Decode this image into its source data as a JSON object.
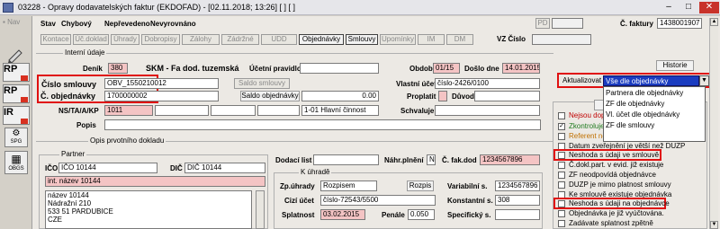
{
  "window": {
    "title": "03228 - Opravy dodavatelských faktur (EKDOFAD) - [02.11.2018; 13:26] [ ] [ ]",
    "minimize": "–",
    "maximize": "□",
    "close": "✕"
  },
  "leftbar": {
    "nav_label": "Nav",
    "btn1": "RP",
    "btn2": "RP",
    "btn3": "IR",
    "btn4_label": "SPG",
    "btn5_label": "OBGS"
  },
  "status": {
    "stav_label": "Stav",
    "stav_value": "Chybový",
    "neprevedeno": "Nepřevedeno",
    "nevyrovnano": "Nevyrovnáno",
    "pd_label": "PD",
    "faktury_label": "Č. faktury",
    "faktury_value": "1438001907"
  },
  "toolbar": {
    "buttons": [
      "Kontace",
      "Úč.doklad",
      "Úhrady",
      "Dobropisy",
      "Zálohy",
      "Zádržné",
      "UDD",
      "Objednávky",
      "Smlouvy",
      "Upomínky",
      "IM",
      "DM"
    ],
    "vz_label": "VZ Číslo",
    "historie": "Historie"
  },
  "interni": {
    "section_title": "Interní údaje",
    "denik_label": "Deník",
    "denik_value": "380",
    "skm": "SKM - Fa dod. tuzemská",
    "ucetni_pravidlo": "Účetní pravidlo",
    "obdobi_label": "Období",
    "obdobi_value": "01/15",
    "doslo_label": "Došlo dne",
    "doslo_value": "14.01.2015",
    "cislo_smlouvy_label": "Číslo smlouvy",
    "cislo_smlouvy_value": "OBV_1550210012",
    "saldo_smlouvy": "Saldo smlouvy",
    "vlastni_ucet_label": "Vlastní účet",
    "vlastni_ucet_value": "číslo-2426/0100",
    "objednavky_label": "Č. objednávky",
    "objednavky_value": "1700000002",
    "saldo_objednavky": "Saldo objednávky",
    "saldo_value": "0.00",
    "proplatit": "Proplatit",
    "duvod": "Důvod",
    "ns_label": "NS/TA/A/KP",
    "ns_value": "1011",
    "ns_text": "1-01 Hlavní činnost",
    "schvaluje": "Schvaluje",
    "popis_label": "Popis"
  },
  "opis": {
    "section_title": "Opis prvotního dokladu",
    "partner_title": "Partner",
    "ico_label": "IČO",
    "ico_value": "IČO 10144",
    "dic_label": "DIČ",
    "dic_value": "DIČ 10144",
    "int_nazev": "int. název 10144",
    "address": [
      "název 10144",
      "Nádražní 210",
      "533 51 PARDUBICE",
      "CZE"
    ],
    "dodaci_list": "Dodací list",
    "nahr_plneni": "Náhr.plnění",
    "nahr_value": "N",
    "fak_dod_label": "Č. fak.dod",
    "fak_dod_value": "1234567896"
  },
  "uhrade": {
    "title": "K úhradě",
    "zp_uhrady_label": "Zp.úhrady",
    "zp_uhrady_value": "Rozpisem",
    "rozpis": "Rozpis",
    "variabilni_label": "Variabilní s.",
    "variabilni_value": "1234567896",
    "cizi_ucet_label": "Cizí účet",
    "cizi_ucet_value": "číslo-72543/5500",
    "konstantni_label": "Konstantní s.",
    "konstantni_value": "308",
    "splatnost_label": "Splatnost",
    "splatnost_value": "03.02.2015",
    "penale_label": "Penále",
    "penale_value": "0.050",
    "specificky_label": "Specifický s."
  },
  "aktualizovat": {
    "label": "Aktualizovat",
    "selected": "Vše dle objednávky",
    "options": [
      "Partnera dle objednávky",
      "ZF dle objednávky",
      "Vl. účet dle objednávky",
      "ZF dle smlouvy"
    ],
    "kontrola_partial": "Kontr"
  },
  "checks": {
    "items": [
      {
        "label": "Nejsou dopl",
        "checked": false,
        "color": "red"
      },
      {
        "label": "Zkontroluje",
        "checked": true,
        "color": "green"
      },
      {
        "label": "Referent ne",
        "checked": false,
        "color": "orange"
      },
      {
        "label": "Datum zveřejnění je větší než DUZP",
        "checked": false,
        "color": "black"
      },
      {
        "label": "Neshoda s údaji ve smlouvě",
        "checked": false,
        "color": "black"
      },
      {
        "label": "Č.dokl.part. v evid. již existuje",
        "checked": false,
        "color": "black"
      },
      {
        "label": "ZF neodpovídá objednávce",
        "checked": false,
        "color": "black"
      },
      {
        "label": "DUZP je mimo platnost smlouvy",
        "checked": false,
        "color": "black"
      },
      {
        "label": "Ke smlouvě existuje objednávka",
        "checked": false,
        "color": "black"
      },
      {
        "label": "Neshoda s údaji na objednávce",
        "checked": false,
        "color": "black"
      },
      {
        "label": "Objednávka je již vyúčtována.",
        "checked": false,
        "color": "black"
      },
      {
        "label": "Zadávate splatnost zpětně",
        "checked": false,
        "color": "black"
      }
    ]
  }
}
